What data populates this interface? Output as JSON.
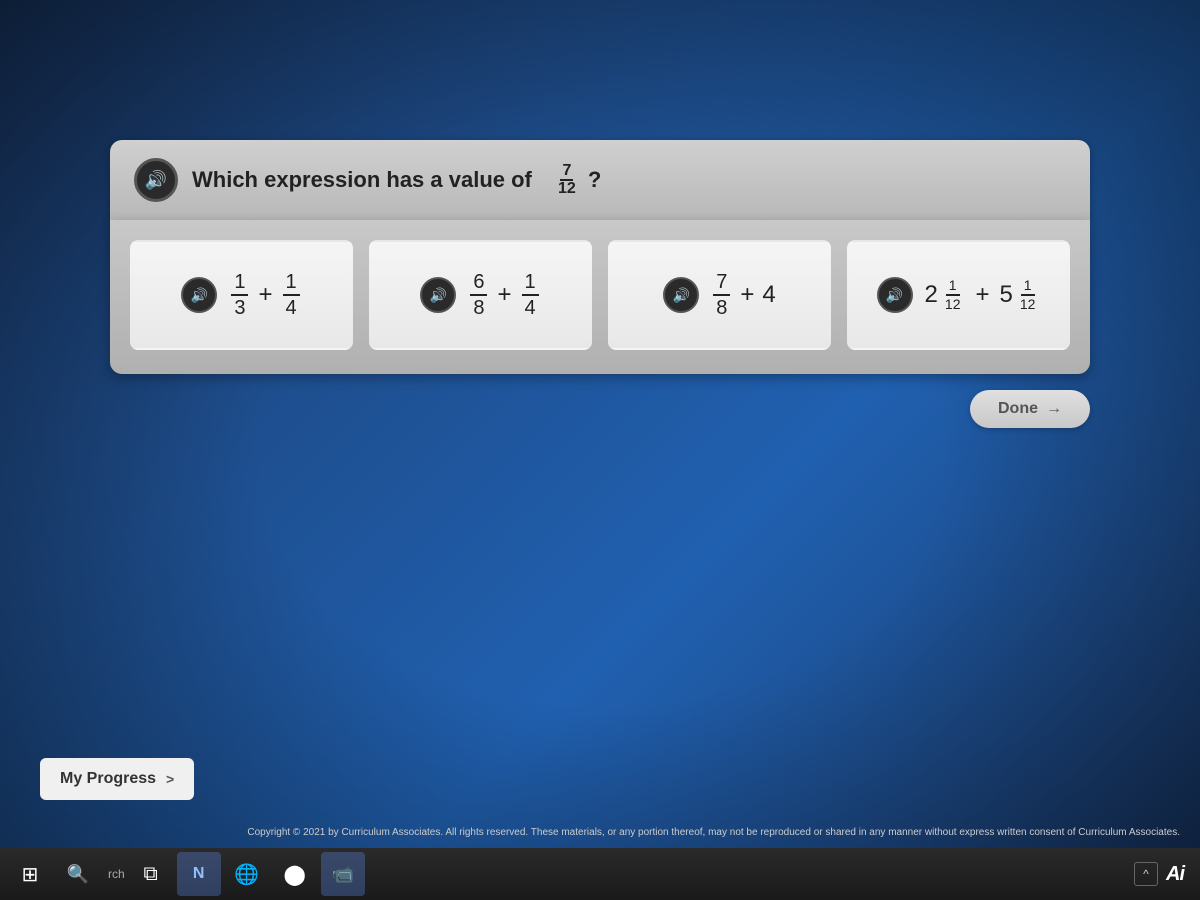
{
  "question": {
    "text": "Which expression has a value of",
    "fraction": {
      "numerator": "7",
      "denominator": "12"
    },
    "question_mark": "?"
  },
  "options": [
    {
      "id": "option-a",
      "label": "1/3 + 1/4",
      "math": {
        "type": "fraction_plus_fraction",
        "left_num": "1",
        "left_den": "3",
        "right_num": "1",
        "right_den": "4"
      }
    },
    {
      "id": "option-b",
      "label": "6/8 + 1/4",
      "math": {
        "type": "fraction_plus_fraction",
        "left_num": "6",
        "left_den": "8",
        "right_num": "1",
        "right_den": "4"
      }
    },
    {
      "id": "option-c",
      "label": "7/8 + 4",
      "math": {
        "type": "fraction_plus_whole",
        "left_num": "7",
        "left_den": "8",
        "right_whole": "4"
      }
    },
    {
      "id": "option-d",
      "label": "2 1/12 + 5 1/12",
      "math": {
        "type": "mixed_plus_mixed",
        "left_whole": "2",
        "left_num": "1",
        "left_den": "12",
        "right_whole": "5",
        "right_num": "1",
        "right_den": "12"
      }
    }
  ],
  "done_button": {
    "label": "Done",
    "arrow": "→"
  },
  "my_progress": {
    "label": "My Progress",
    "chevron": ">"
  },
  "copyright": "Copyright © 2021 by Curriculum Associates. All rights reserved. These materials, or any portion thereof, may not be reproduced or shared in any manner without express written consent of Curriculum Associates.",
  "taskbar": {
    "search_label": "rch",
    "ai_label": "Ai",
    "up_arrow": "^"
  }
}
